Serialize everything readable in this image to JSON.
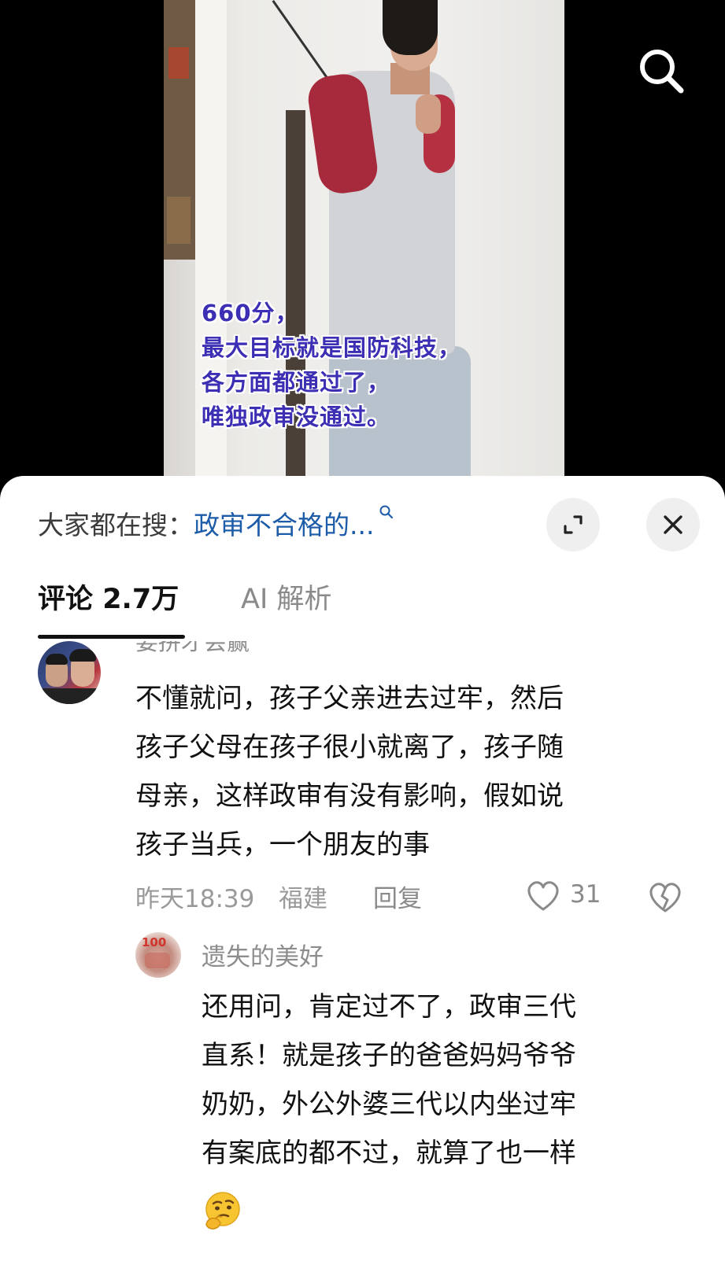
{
  "video": {
    "overlay_lines": [
      "660分，",
      "最大目标就是国防科技，",
      "各方面都通过了，",
      "唯独政审没通过。"
    ],
    "search_icon": "search-icon"
  },
  "sheet": {
    "search_prefix": "大家都在搜：",
    "search_suggestion": "政审不合格的...",
    "expand_icon": "expand-icon",
    "close_icon": "close-icon",
    "tabs": {
      "comments_label": "评论",
      "comments_count": "2.7万",
      "ai_label": "AI 解析"
    }
  },
  "comment": {
    "username_partial": "要拼才会赢",
    "body_lines": [
      "不懂就问，孩子父亲进去过牢，然后",
      "孩子父母在孩子很小就离了，孩子随",
      "母亲，这样政审有没有影响，假如说",
      "孩子当兵，一个朋友的事"
    ],
    "time": "昨天18:39",
    "location": "福建",
    "reply_label": "回复",
    "likes": "31"
  },
  "reply": {
    "avatar_text": "100",
    "username": "遗失的美好",
    "body_lines": [
      "还用问，肯定过不了，政审三代",
      "直系！就是孩子的爸爸妈妈爷爷",
      "奶奶，外公外婆三代以内坐过牢",
      "有案底的都不过，就算了也一样"
    ],
    "emoji": "thinking-face-emoji"
  },
  "colors": {
    "overlay_text": "#3c2fb3",
    "search_suggestion": "#1d5ca8",
    "muted_text": "#9a9a9a",
    "primary_text": "#111111",
    "button_bg": "#efefef"
  }
}
